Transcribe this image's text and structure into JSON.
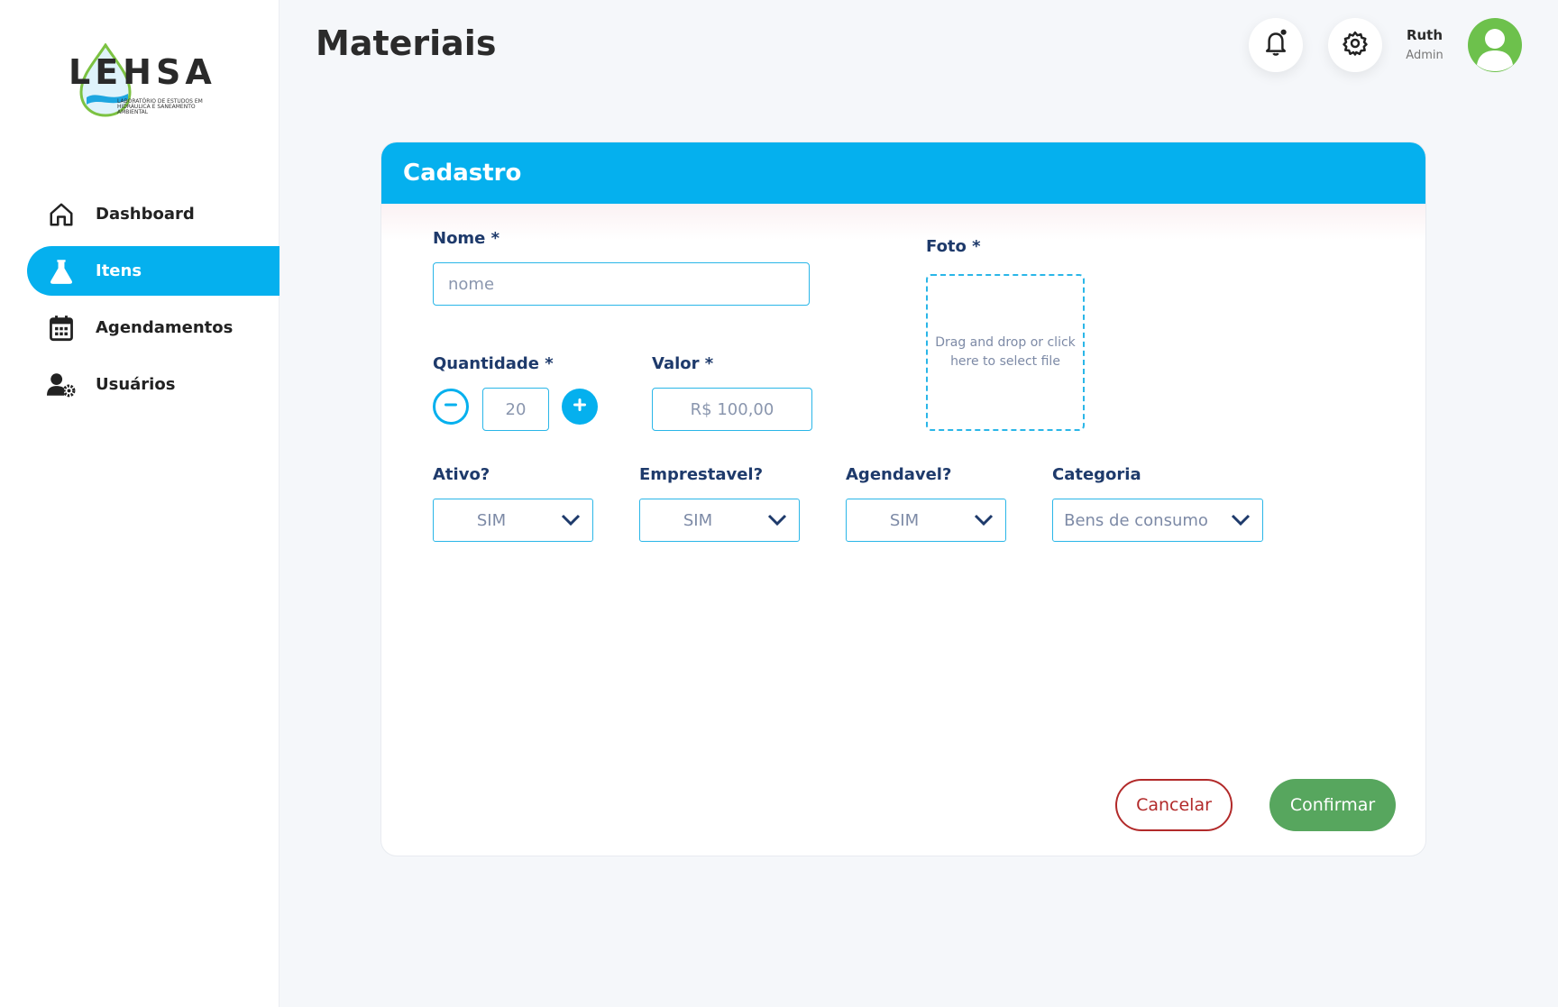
{
  "app": {
    "logo_text": "LEHSA",
    "logo_subtitle": "LABORATÓRIO DE ESTUDOS EM HIDRÁULICA E SANEAMENTO AMBIENTAL"
  },
  "sidebar": {
    "items": [
      {
        "label": "Dashboard",
        "icon": "home-icon",
        "active": false
      },
      {
        "label": "Itens",
        "icon": "flask-icon",
        "active": true
      },
      {
        "label": "Agendamentos",
        "icon": "calendar-icon",
        "active": false
      },
      {
        "label": "Usuários",
        "icon": "user-settings-icon",
        "active": false
      }
    ]
  },
  "header": {
    "title": "Materiais",
    "user_name": "Ruth",
    "user_role": "Admin"
  },
  "form": {
    "title": "Cadastro",
    "nome": {
      "label": "Nome *",
      "placeholder": "nome",
      "value": ""
    },
    "quantidade": {
      "label": "Quantidade *",
      "value": "20"
    },
    "valor": {
      "label": "Valor *",
      "value": "R$ 100,00"
    },
    "foto": {
      "label": "Foto *",
      "dropzone_text": "Drag and drop or click here to select file"
    },
    "ativo": {
      "label": "Ativo?",
      "value": "SIM"
    },
    "emprestavel": {
      "label": "Emprestavel?",
      "value": "SIM"
    },
    "agendavel": {
      "label": "Agendavel?",
      "value": "SIM"
    },
    "categoria": {
      "label": "Categoria",
      "value": "Bens de consumo"
    },
    "cancel_label": "Cancelar",
    "confirm_label": "Confirmar"
  },
  "colors": {
    "accent": "#05b0ee",
    "cancel": "#b22a2a",
    "confirm": "#57a65e",
    "avatar": "#6dc14c"
  }
}
